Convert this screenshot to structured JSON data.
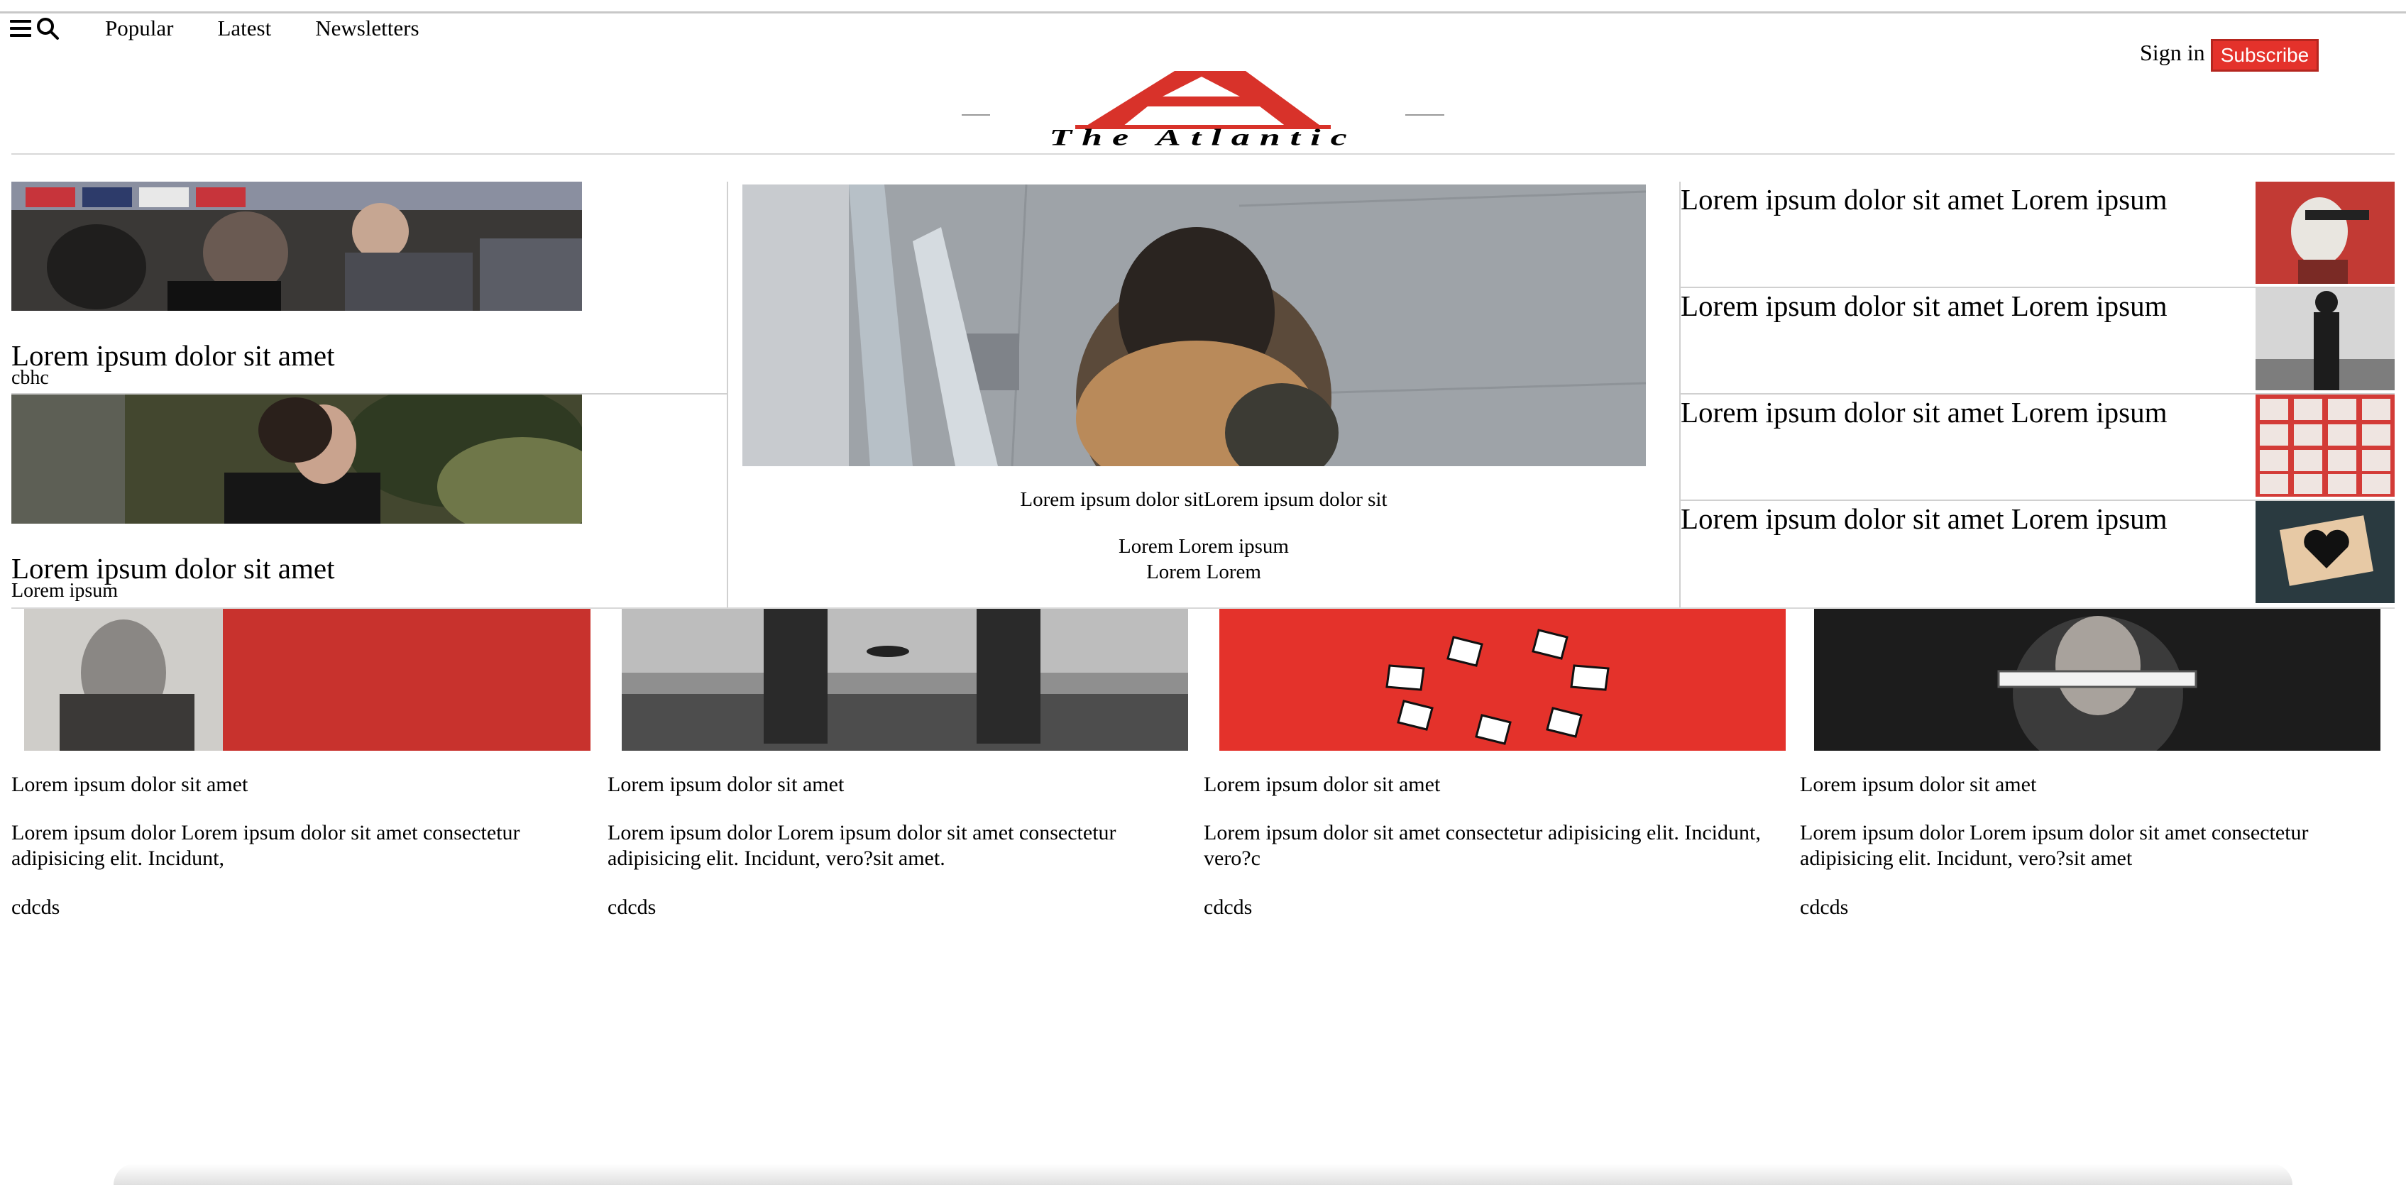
{
  "nav": {
    "links": [
      "Popular",
      "Latest",
      "Newsletters"
    ]
  },
  "header": {
    "sign_in": "Sign in",
    "subscribe": "Subscribe",
    "logo_text": "The Atlantic",
    "brand_color": "#e4322b"
  },
  "left_stories": [
    {
      "headline": "Lorem ipsum dolor sit amet",
      "byline": "cbhc"
    },
    {
      "headline": "Lorem ipsum dolor sit amet",
      "byline": "Lorem ipsum"
    }
  ],
  "center": {
    "caption": "Lorem ipsum dolor sitLorem ipsum dolor sit",
    "sub_line1": "Lorem Lorem ipsum",
    "sub_line2": "Lorem Lorem"
  },
  "right_items": [
    {
      "headline": "Lorem ipsum dolor sit amet Lorem ipsum"
    },
    {
      "headline": "Lorem ipsum dolor sit amet Lorem ipsum"
    },
    {
      "headline": "Lorem ipsum dolor sit amet Lorem ipsum"
    },
    {
      "headline": "Lorem ipsum dolor sit amet Lorem ipsum"
    }
  ],
  "cards": [
    {
      "title": "Lorem ipsum dolor sit amet",
      "desc": "Lorem ipsum dolor Lorem ipsum dolor sit amet consectetur adipisicing elit. Incidunt,",
      "tag": "cdcds"
    },
    {
      "title": "Lorem ipsum dolor sit amet",
      "desc": "Lorem ipsum dolor Lorem ipsum dolor sit amet consectetur adipisicing elit. Incidunt, vero?sit amet.",
      "tag": "cdcds"
    },
    {
      "title": "Lorem ipsum dolor sit amet",
      "desc": "Lorem ipsum dolor sit amet consectetur adipisicing elit. Incidunt, vero?c",
      "tag": "cdcds"
    },
    {
      "title": "Lorem ipsum dolor sit amet",
      "desc": "Lorem ipsum dolor Lorem ipsum dolor sit amet consectetur adipisicing elit. Incidunt, vero?sit amet",
      "tag": "cdcds"
    }
  ]
}
